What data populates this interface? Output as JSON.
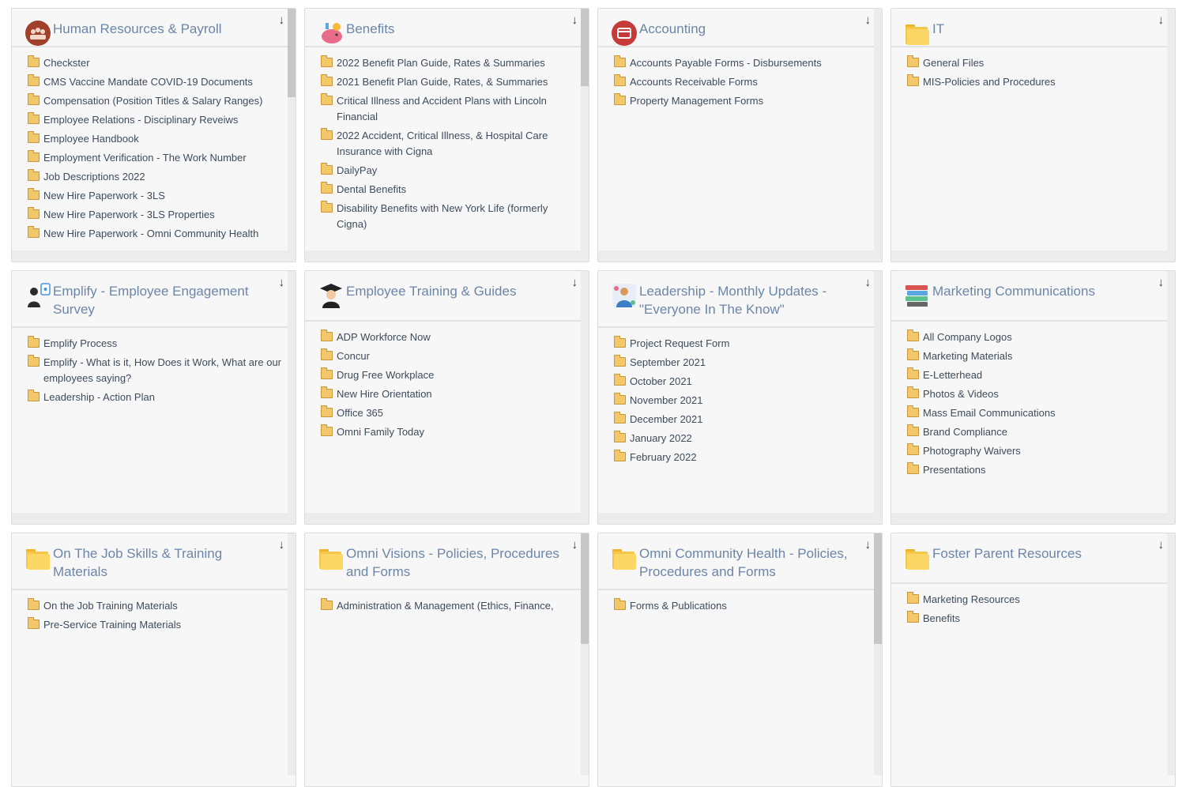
{
  "cards": [
    {
      "title": "Human Resources & Payroll",
      "items": [
        "Checkster",
        "CMS Vaccine Mandate COVID-19 Documents",
        "Compensation (Position Titles & Salary Ranges)",
        "Employee Relations - Disciplinary Reveiws",
        "Employee Handbook",
        "Employment Verification - The Work Number",
        "Job Descriptions 2022",
        "New Hire Paperwork - 3LS",
        "New Hire Paperwork - 3LS Properties",
        "New Hire Paperwork - Omni Community Health"
      ]
    },
    {
      "title": "Benefits",
      "items": [
        "2022 Benefit Plan Guide, Rates & Summaries",
        "2021 Benefit Plan Guide, Rates, & Summaries",
        "Critical Illness and Accident Plans with Lincoln Financial",
        "2022 Accident, Critical Illness, & Hospital Care Insurance with Cigna",
        "DailyPay",
        "Dental Benefits",
        "Disability Benefits with New York Life (formerly Cigna)"
      ]
    },
    {
      "title": "Accounting",
      "items": [
        "Accounts Payable Forms - Disbursements",
        "Accounts Receivable Forms",
        "Property Management Forms"
      ]
    },
    {
      "title": "IT",
      "items": [
        "General Files",
        "MIS-Policies and Procedures"
      ]
    },
    {
      "title": "Emplify - Employee Engagement Survey",
      "items": [
        "Emplify Process",
        "Emplify - What is it, How Does it Work, What are our employees saying?",
        "Leadership - Action Plan"
      ]
    },
    {
      "title": "Employee Training & Guides",
      "items": [
        "ADP Workforce Now",
        "Concur",
        "Drug Free Workplace",
        "New Hire Orientation",
        "Office 365",
        "Omni Family Today"
      ]
    },
    {
      "title": "Leadership - Monthly Updates - \"Everyone In The Know\"",
      "items": [
        "Project Request Form",
        "September 2021",
        "October 2021",
        "November 2021",
        "December 2021",
        "January 2022",
        "February 2022"
      ]
    },
    {
      "title": "Marketing Communications",
      "items": [
        "All Company Logos",
        "Marketing Materials",
        "E-Letterhead",
        "Photos & Videos",
        "Mass Email Communications",
        "Brand Compliance",
        "Photography Waivers",
        "Presentations"
      ]
    },
    {
      "title": "On The Job Skills & Training Materials",
      "items": [
        "On the Job Training Materials",
        "Pre-Service Training Materials"
      ]
    },
    {
      "title": "Omni Visions - Policies, Procedures and Forms",
      "items": [
        "Administration & Management (Ethics, Finance,"
      ]
    },
    {
      "title": "Omni Community Health - Policies, Procedures and Forms",
      "items": [
        "Forms & Publications"
      ]
    },
    {
      "title": "Foster Parent Resources",
      "items": [
        "Marketing Resources",
        "Benefits"
      ]
    }
  ],
  "icons": {
    "collapse": "arrow-down-icon",
    "folder": "folder-icon"
  }
}
